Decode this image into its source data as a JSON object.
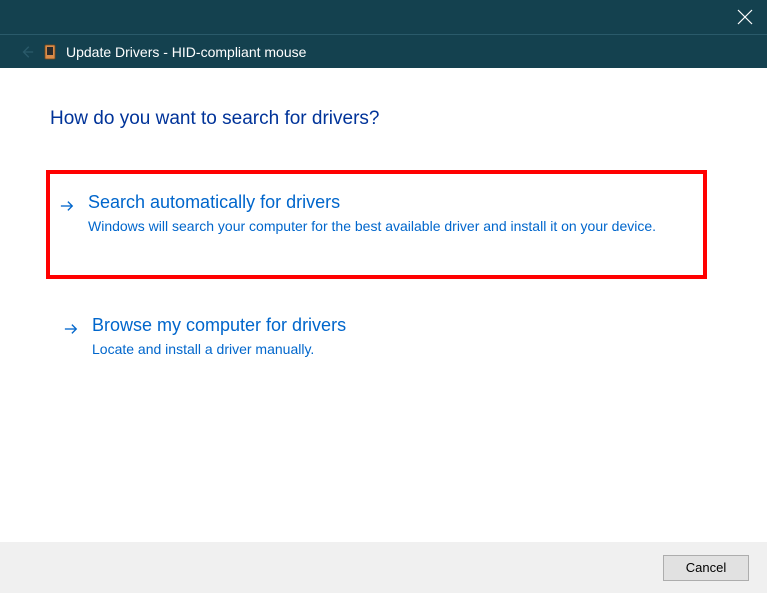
{
  "colors": {
    "titlebar_bg": "#14414f",
    "accent_link": "#0066cc",
    "heading": "#003399",
    "highlight_border": "#ff0000"
  },
  "header": {
    "title": "Update Drivers - HID-compliant mouse"
  },
  "question": "How do you want to search for drivers?",
  "options": [
    {
      "title": "Search automatically for drivers",
      "description": "Windows will search your computer for the best available driver and install it on your device.",
      "highlighted": true
    },
    {
      "title": "Browse my computer for drivers",
      "description": "Locate and install a driver manually.",
      "highlighted": false
    }
  ],
  "footer": {
    "cancel_label": "Cancel"
  }
}
